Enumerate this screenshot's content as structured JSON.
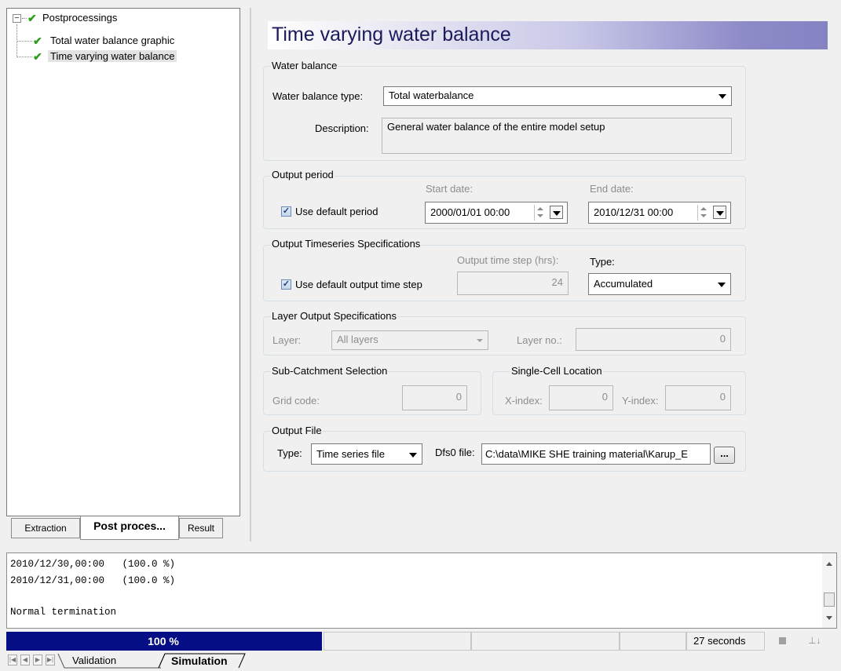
{
  "tree": {
    "root_label": "Postprocessings",
    "children": [
      "Total water balance graphic",
      "Time varying water balance"
    ]
  },
  "left_tabs": [
    "Extraction",
    "Post proces...",
    "Result"
  ],
  "panel": {
    "title": "Time varying water balance",
    "water_balance": {
      "group_title": "Water balance",
      "type_label": "Water balance type:",
      "type_value": "Total waterbalance",
      "description_label": "Description:",
      "description_value": "General water balance of the entire model setup"
    },
    "output_period": {
      "group_title": "Output period",
      "start_label": "Start date:",
      "end_label": "End date:",
      "use_default_label": "Use default period",
      "use_default_checked": true,
      "start_value": "2000/01/01  00:00",
      "end_value": "2010/12/31  00:00"
    },
    "timeseries": {
      "group_title": "Output Timeseries Specifications",
      "step_label": "Output time step (hrs):",
      "type_label": "Type:",
      "use_default_label": "Use default output time step",
      "use_default_checked": true,
      "step_value": "24",
      "type_value": "Accumulated"
    },
    "layer": {
      "group_title": "Layer Output Specifications",
      "layer_label": "Layer:",
      "layer_value": "All layers",
      "layer_no_label": "Layer no.:",
      "layer_no_value": "0"
    },
    "subcatchment": {
      "group_title": "Sub-Catchment Selection",
      "grid_code_label": "Grid code:",
      "grid_code_value": "0"
    },
    "single_cell": {
      "group_title": "Single-Cell Location",
      "x_label": "X-index:",
      "x_value": "0",
      "y_label": "Y-index:",
      "y_value": "0"
    },
    "output_file": {
      "group_title": "Output File",
      "type_label": "Type:",
      "type_value": "Time series file",
      "dfs0_label": "Dfs0 file:",
      "dfs0_value": "C:\\data\\MIKE SHE training material\\Karup_E",
      "browse_label": "..."
    }
  },
  "log": {
    "lines": [
      "2010/12/30,00:00   (100.0 %)",
      "2010/12/31,00:00   (100.0 %)",
      "",
      "Normal termination"
    ]
  },
  "status": {
    "progress_text": "100 %",
    "progress_fraction": 1.0,
    "elapsed": "27 seconds"
  },
  "bottom_tabs": [
    "Validation",
    "Simulation"
  ],
  "colors": {
    "progress": "#050e85",
    "check": "#2e9c1c",
    "title_gradient_end": "#8583c2"
  }
}
